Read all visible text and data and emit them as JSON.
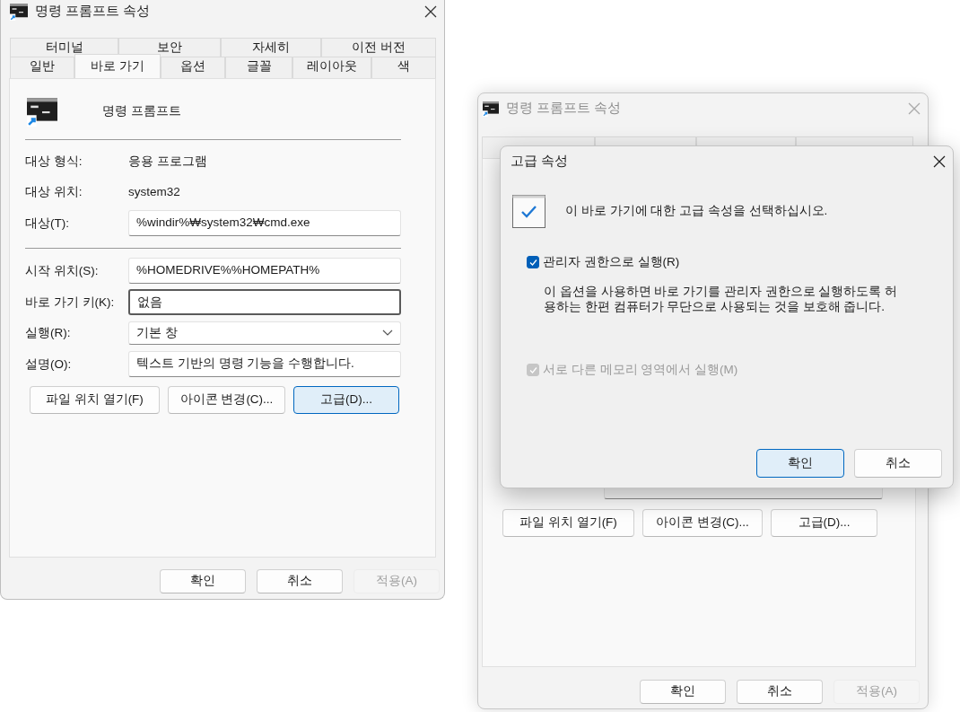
{
  "main_window": {
    "title": "명령 프롬프트 속성",
    "active": true,
    "tabs_back_row": [
      {
        "label": "터미널",
        "selected": false
      },
      {
        "label": "보안",
        "selected": false
      },
      {
        "label": "자세히",
        "selected": false
      },
      {
        "label": "이전 버전",
        "selected": false
      }
    ],
    "tabs_front_row": [
      {
        "label": "일반",
        "selected": false
      },
      {
        "label": "바로 가기",
        "selected": true
      },
      {
        "label": "옵션",
        "selected": false
      },
      {
        "label": "글꼴",
        "selected": false
      },
      {
        "label": "레이아웃",
        "selected": false
      },
      {
        "label": "색",
        "selected": false
      }
    ],
    "shortcut_name": "명령 프롬프트",
    "sections": [
      [
        {
          "kind": "text",
          "label": "대상 형식:",
          "value": "응용 프로그램"
        },
        {
          "kind": "text",
          "label": "대상 위치:",
          "value": "system32"
        },
        {
          "kind": "input",
          "label": "대상(T):",
          "value": "%windir%₩system32₩cmd.exe",
          "focused": false
        }
      ],
      [
        {
          "kind": "input",
          "label": "시작 위치(S):",
          "value": "%HOMEDRIVE%%HOMEPATH%",
          "focused": false
        },
        {
          "kind": "input",
          "label": "바로 가기 키(K):",
          "value": "없음",
          "focused": true
        },
        {
          "kind": "select",
          "label": "실행(R):",
          "value": "기본 창",
          "focused": false
        },
        {
          "kind": "input",
          "label": "설명(O):",
          "value": "텍스트 기반의 명령 기능을 수행합니다.",
          "focused": false
        }
      ]
    ],
    "actions": [
      {
        "label": "파일 위치 열기(F)",
        "default": false,
        "disabled": false
      },
      {
        "label": "아이콘 변경(C)...",
        "default": false,
        "disabled": false
      },
      {
        "label": "고급(D)...",
        "default": true,
        "disabled": false
      }
    ],
    "footer_buttons": [
      {
        "label": "확인",
        "default": false,
        "disabled": false
      },
      {
        "label": "취소",
        "default": false,
        "disabled": false
      },
      {
        "label": "적용(A)",
        "default": false,
        "disabled": true
      }
    ]
  },
  "background_window": {
    "title": "명령 프롬프트 속성",
    "active": false,
    "actions": [
      {
        "label": "파일 위치 열기(F)",
        "default": false,
        "disabled": false
      },
      {
        "label": "아이콘 변경(C)...",
        "default": false,
        "disabled": false
      },
      {
        "label": "고급(D)...",
        "default": false,
        "disabled": false
      }
    ],
    "footer_buttons": [
      {
        "label": "확인",
        "default": false,
        "disabled": false
      },
      {
        "label": "취소",
        "default": false,
        "disabled": false
      },
      {
        "label": "적용(A)",
        "default": false,
        "disabled": true
      }
    ]
  },
  "advanced_dialog": {
    "title": "고급 속성",
    "active": true,
    "prompt": "이 바로 가기에 대한 고급 속성을 선택하십시오.",
    "options": [
      {
        "label": "관리자 권한으로 실행(R)",
        "checked": true,
        "disabled": false,
        "description_lines": [
          "이 옵션을 사용하면 바로 가기를 관리자 권한으로 실행하도록 허",
          "용하는 한편 컴퓨터가 무단으로 사용되는 것을 보호해 줍니다."
        ]
      },
      {
        "label": "서로 다른 메모리 영역에서 실행(M)",
        "checked": true,
        "disabled": true
      }
    ],
    "buttons": [
      {
        "label": "확인",
        "default": true,
        "disabled": false
      },
      {
        "label": "취소",
        "default": false,
        "disabled": false
      }
    ]
  }
}
